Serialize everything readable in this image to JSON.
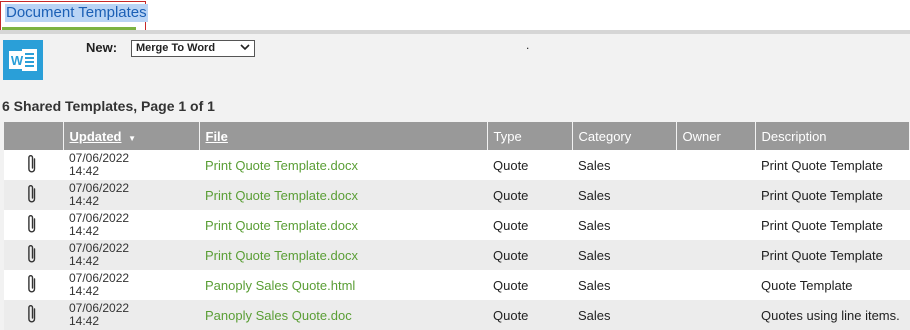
{
  "tab": {
    "label": "Document Templates"
  },
  "toolbar": {
    "new_label": "New:",
    "new_select_value": "Merge To Word",
    "word_icon": "word-icon",
    "dot": "."
  },
  "summary": "6 Shared Templates, Page 1 of 1",
  "table": {
    "headers": {
      "updated": "Updated",
      "sort_indicator": "▼",
      "file": "File",
      "type": "Type",
      "category": "Category",
      "owner": "Owner",
      "description": "Description"
    },
    "rows": [
      {
        "date": "07/06/2022",
        "time": "14:42",
        "file": "Print Quote Template.docx",
        "type": "Quote",
        "category": "Sales",
        "owner": "",
        "description": "Print Quote Template"
      },
      {
        "date": "07/06/2022",
        "time": "14:42",
        "file": "Print Quote Template.docx",
        "type": "Quote",
        "category": "Sales",
        "owner": "",
        "description": "Print Quote Template"
      },
      {
        "date": "07/06/2022",
        "time": "14:42",
        "file": "Print Quote Template.docx",
        "type": "Quote",
        "category": "Sales",
        "owner": "",
        "description": "Print Quote Template"
      },
      {
        "date": "07/06/2022",
        "time": "14:42",
        "file": "Print Quote Template.docx",
        "type": "Quote",
        "category": "Sales",
        "owner": "",
        "description": "Print Quote Template"
      },
      {
        "date": "07/06/2022",
        "time": "14:42",
        "file": "Panoply Sales Quote.html",
        "type": "Quote",
        "category": "Sales",
        "owner": "",
        "description": "Quote Template"
      },
      {
        "date": "07/06/2022",
        "time": "14:42",
        "file": "Panoply Sales Quote.doc",
        "type": "Quote",
        "category": "Sales",
        "owner": "",
        "description": "Quotes using line items."
      }
    ]
  },
  "colors": {
    "accent_green": "#7cb342",
    "link_green": "#5a9e35",
    "header_gray": "#999999",
    "word_blue": "#2a9fd8"
  }
}
